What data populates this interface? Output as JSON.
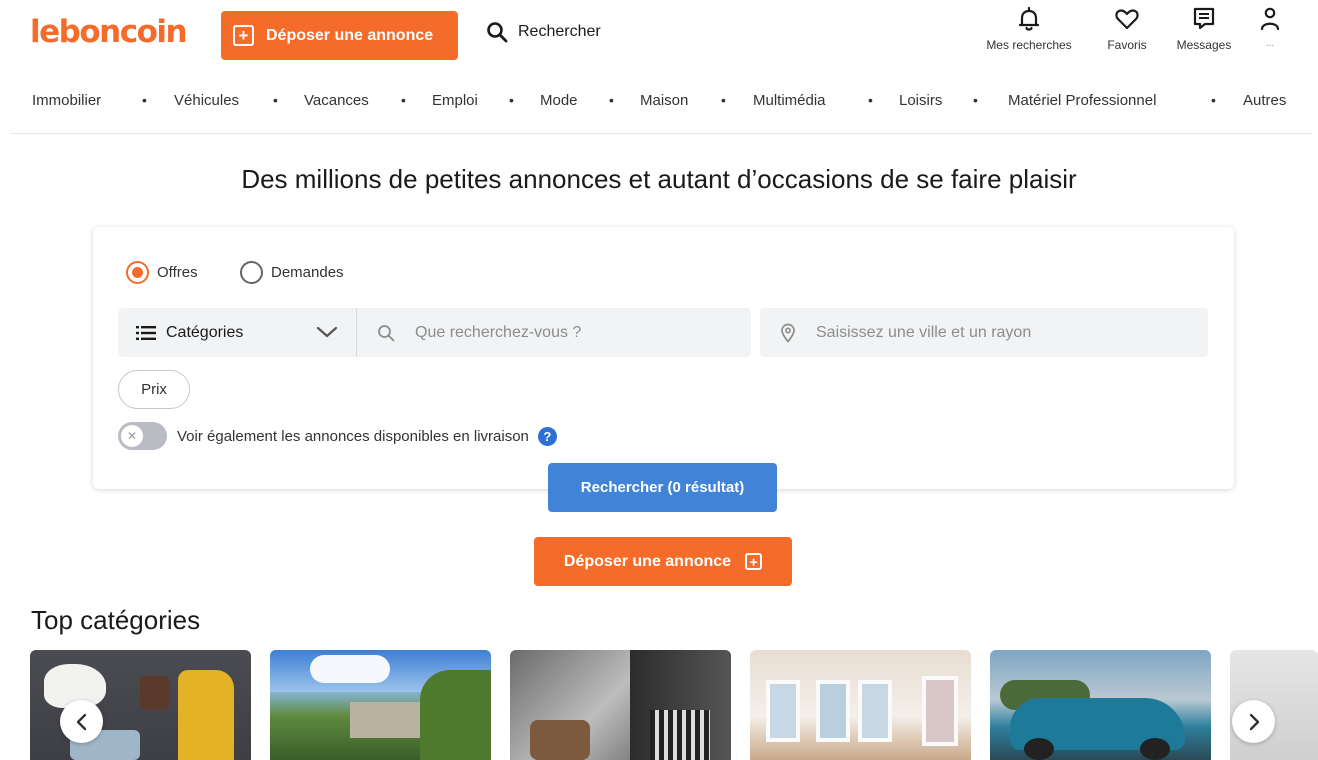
{
  "header": {
    "logo": "leboncoin",
    "post_ad_label": "Déposer une annonce",
    "search_label": "Rechercher",
    "user_nav": [
      {
        "label": "Mes recherches",
        "icon": "bell-icon"
      },
      {
        "label": "Favoris",
        "icon": "heart-icon"
      },
      {
        "label": "Messages",
        "icon": "message-icon"
      },
      {
        "label": "...",
        "icon": "user-icon"
      }
    ]
  },
  "categories": [
    "Immobilier",
    "Véhicules",
    "Vacances",
    "Emploi",
    "Mode",
    "Maison",
    "Multimédia",
    "Loisirs",
    "Matériel Professionnel",
    "Autres"
  ],
  "hero": {
    "title": "Des millions de petites annonces et autant d’occasions de se faire plaisir"
  },
  "search": {
    "type_options": [
      {
        "label": "Offres",
        "selected": true
      },
      {
        "label": "Demandes",
        "selected": false
      }
    ],
    "category_label": "Catégories",
    "query_placeholder": "Que recherchez-vous ?",
    "location_placeholder": "Saisissez une ville et un rayon",
    "price_label": "Prix",
    "delivery_toggle_label": "Voir également les annonces disponibles en livraison",
    "delivery_toggle_on": false,
    "help_glyph": "?",
    "submit_label": "Rechercher (0 résultat)"
  },
  "post_ad": {
    "label": "Déposer une annonce"
  },
  "top_categories": {
    "title": "Top catégories"
  },
  "colors": {
    "brand_orange": "#f56b2a",
    "search_blue": "#4183d7"
  }
}
